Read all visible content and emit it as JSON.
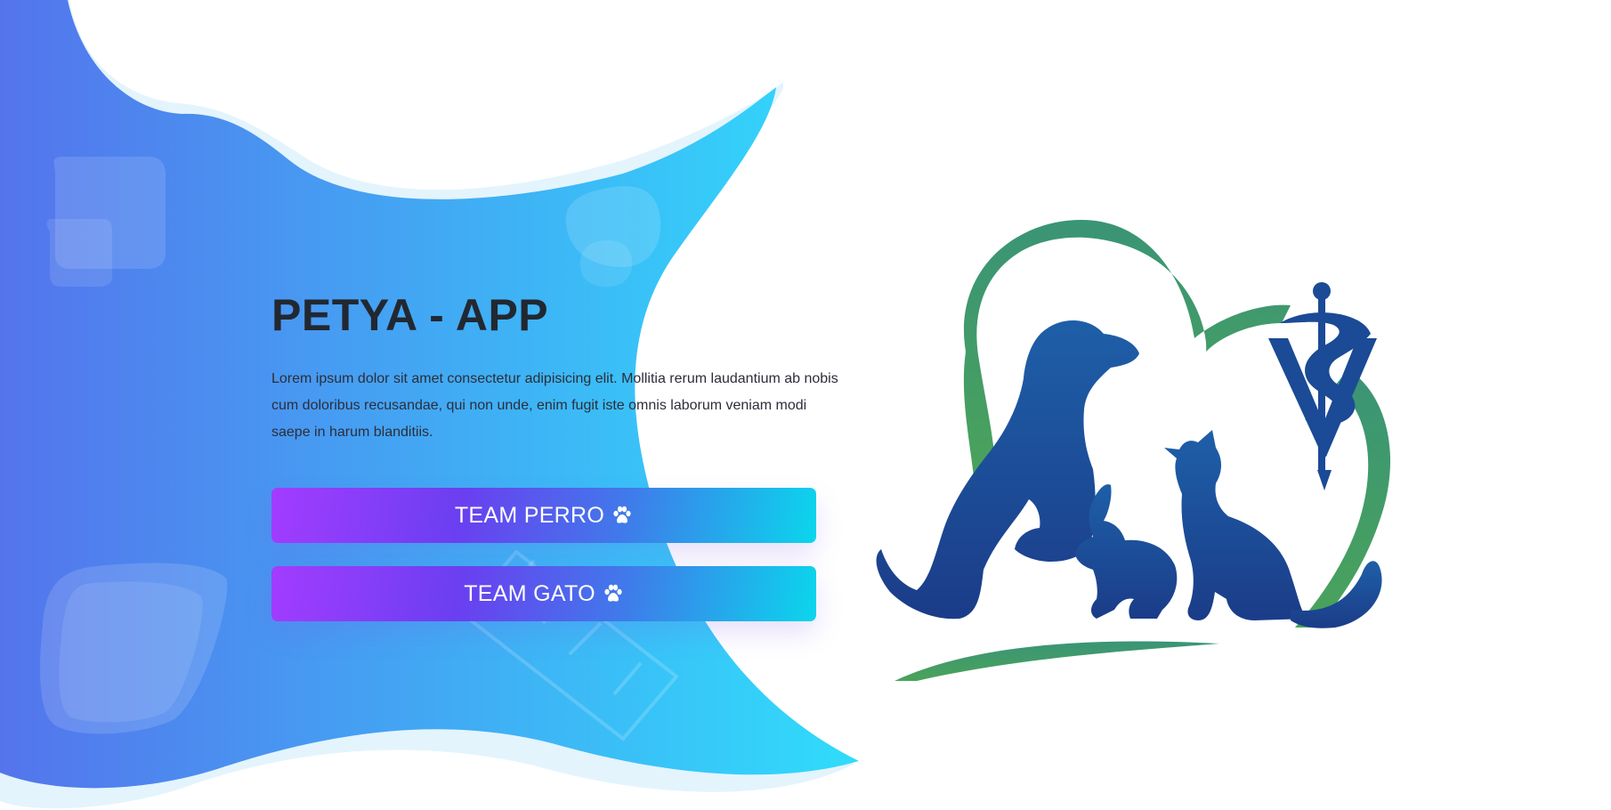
{
  "hero": {
    "title": "PETYA - APP",
    "description": "Lorem ipsum dolor sit amet consectetur adipisicing elit. Mollitia rerum laudantium ab nobis cum doloribus recusandae, qui non unde, enim fugit iste omnis laborum veniam modi saepe in harum blanditiis."
  },
  "buttons": {
    "perro_label": "TEAM PERRO",
    "gato_label": "TEAM GATO"
  },
  "icons": {
    "button_icon": "paw-icon",
    "logo": "veterinary-logo"
  },
  "colors": {
    "background_gradient_start": "#5474ec",
    "background_gradient_end": "#30dcfb",
    "title": "#222831",
    "button_gradient_start": "#a33cff",
    "button_gradient_end": "#0bd6ec",
    "logo_heart": "#3f9a6a",
    "logo_animals": "#1a4590"
  }
}
